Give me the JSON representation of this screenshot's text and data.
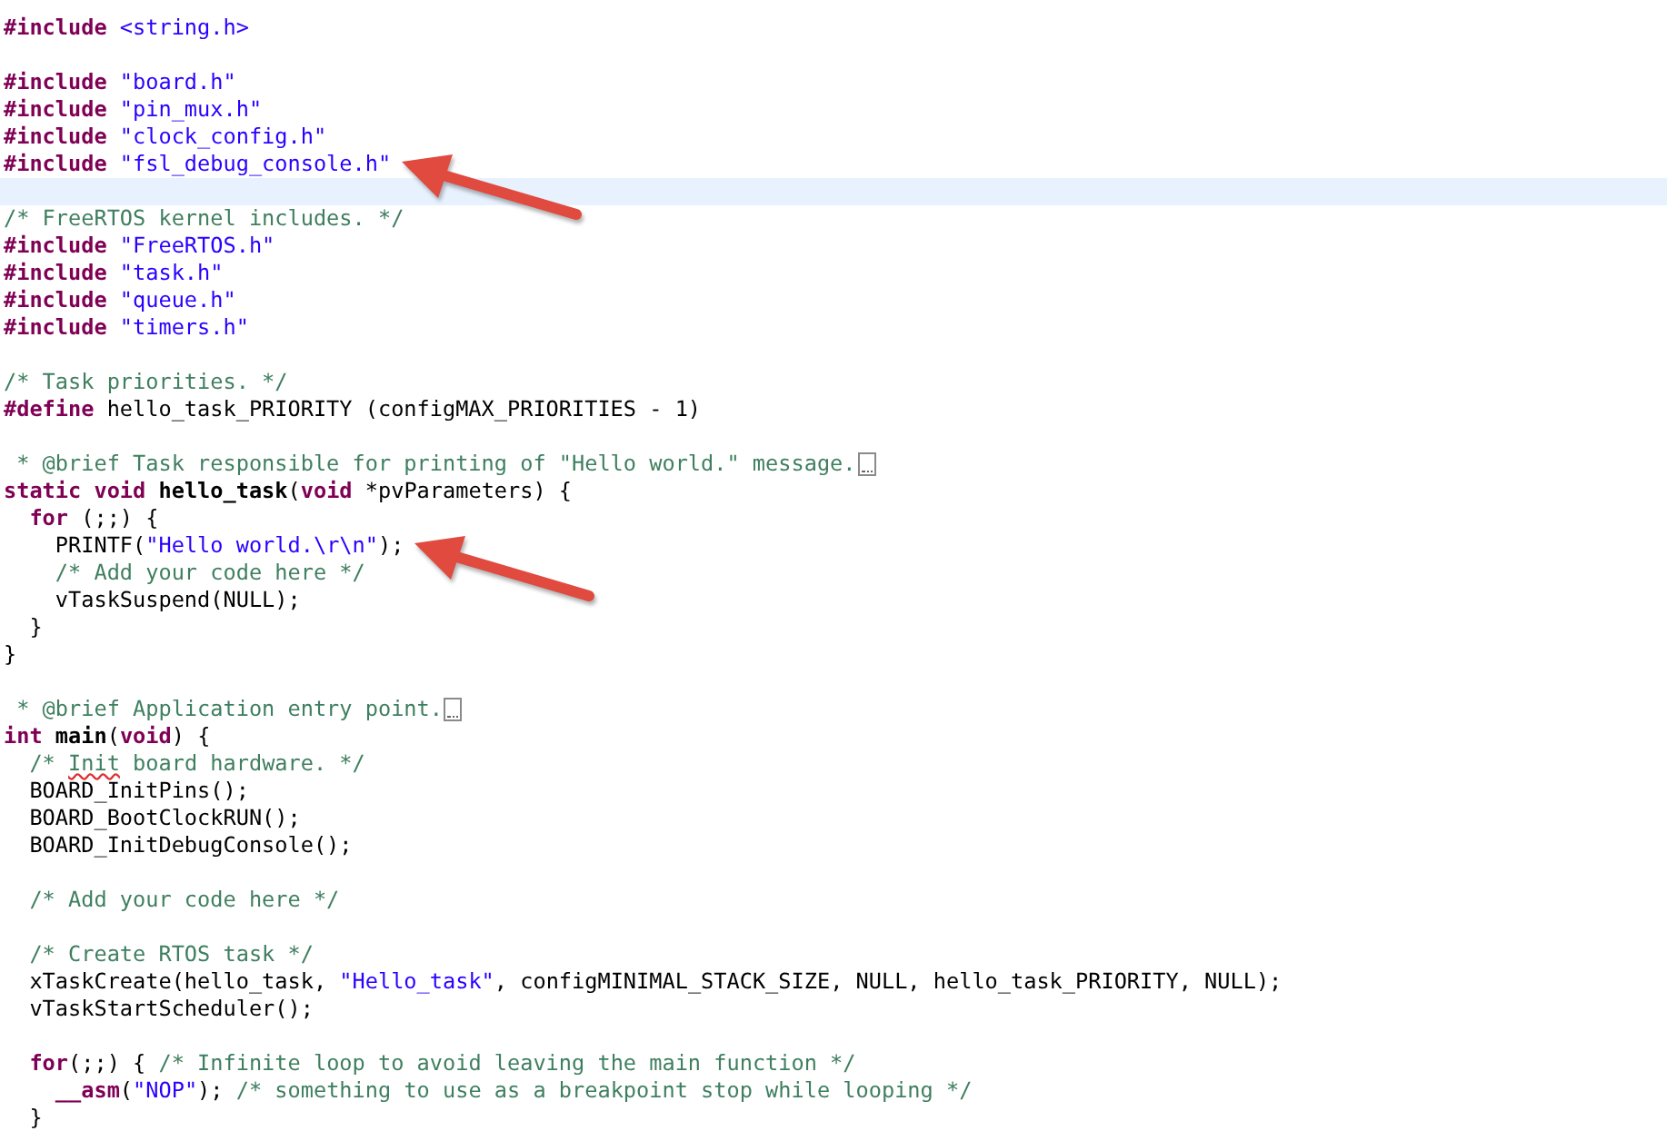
{
  "lines": [
    {
      "kind": "code",
      "tokens": [
        {
          "kind": "keyword",
          "text": "#include "
        },
        {
          "kind": "string",
          "text": "<string.h>"
        }
      ]
    },
    {
      "kind": "blank"
    },
    {
      "kind": "code",
      "tokens": [
        {
          "kind": "keyword",
          "text": "#include "
        },
        {
          "kind": "string",
          "text": "\"board.h\""
        }
      ]
    },
    {
      "kind": "code",
      "tokens": [
        {
          "kind": "keyword",
          "text": "#include "
        },
        {
          "kind": "string",
          "text": "\"pin_mux.h\""
        }
      ]
    },
    {
      "kind": "code",
      "tokens": [
        {
          "kind": "keyword",
          "text": "#include "
        },
        {
          "kind": "string",
          "text": "\"clock_config.h\""
        }
      ]
    },
    {
      "kind": "code",
      "tokens": [
        {
          "kind": "keyword",
          "text": "#include "
        },
        {
          "kind": "string",
          "text": "\"fsl_debug_console.h\""
        }
      ],
      "arrow": true
    },
    {
      "kind": "blank",
      "current": true
    },
    {
      "kind": "code",
      "tokens": [
        {
          "kind": "comment",
          "text": "/* FreeRTOS kernel includes. */"
        }
      ]
    },
    {
      "kind": "code",
      "tokens": [
        {
          "kind": "keyword",
          "text": "#include "
        },
        {
          "kind": "string",
          "text": "\"FreeRTOS.h\""
        }
      ]
    },
    {
      "kind": "code",
      "tokens": [
        {
          "kind": "keyword",
          "text": "#include "
        },
        {
          "kind": "string",
          "text": "\"task.h\""
        }
      ]
    },
    {
      "kind": "code",
      "tokens": [
        {
          "kind": "keyword",
          "text": "#include "
        },
        {
          "kind": "string",
          "text": "\"queue.h\""
        }
      ]
    },
    {
      "kind": "code",
      "tokens": [
        {
          "kind": "keyword",
          "text": "#include "
        },
        {
          "kind": "string",
          "text": "\"timers.h\""
        }
      ]
    },
    {
      "kind": "blank"
    },
    {
      "kind": "code",
      "tokens": [
        {
          "kind": "comment",
          "text": "/* Task priorities. */"
        }
      ]
    },
    {
      "kind": "code",
      "tokens": [
        {
          "kind": "keyword",
          "text": "#define"
        },
        {
          "kind": "plain",
          "text": " hello_task_PRIORITY (configMAX_PRIORITIES - 1)"
        }
      ]
    },
    {
      "kind": "blank"
    },
    {
      "kind": "code",
      "tokens": [
        {
          "kind": "comment",
          "text": " * @brief Task responsible for printing of \"Hello world.\" message."
        }
      ],
      "folded": true
    },
    {
      "kind": "code",
      "tokens": [
        {
          "kind": "keyword",
          "text": "static void "
        },
        {
          "kind": "function",
          "text": "hello_task"
        },
        {
          "kind": "plain",
          "text": "("
        },
        {
          "kind": "keyword",
          "text": "void"
        },
        {
          "kind": "plain",
          "text": " *pvParameters) {"
        }
      ]
    },
    {
      "kind": "code",
      "tokens": [
        {
          "kind": "keyword",
          "text": "  for"
        },
        {
          "kind": "plain",
          "text": " (;;) {"
        }
      ]
    },
    {
      "kind": "code",
      "tokens": [
        {
          "kind": "plain",
          "text": "    PRINTF("
        },
        {
          "kind": "string",
          "text": "\"Hello world.\\r\\n\""
        },
        {
          "kind": "plain",
          "text": ");"
        }
      ],
      "arrow": true
    },
    {
      "kind": "code",
      "tokens": [
        {
          "kind": "comment",
          "text": "    /* Add your code here */"
        }
      ]
    },
    {
      "kind": "code",
      "tokens": [
        {
          "kind": "plain",
          "text": "    vTaskSuspend(NULL);"
        }
      ]
    },
    {
      "kind": "code",
      "tokens": [
        {
          "kind": "plain",
          "text": "  }"
        }
      ]
    },
    {
      "kind": "code",
      "tokens": [
        {
          "kind": "plain",
          "text": "}"
        }
      ]
    },
    {
      "kind": "blank"
    },
    {
      "kind": "code",
      "tokens": [
        {
          "kind": "comment",
          "text": " * @brief Application entry point."
        }
      ],
      "folded": true
    },
    {
      "kind": "code",
      "tokens": [
        {
          "kind": "keyword",
          "text": "int "
        },
        {
          "kind": "function",
          "text": "main"
        },
        {
          "kind": "plain",
          "text": "("
        },
        {
          "kind": "keyword",
          "text": "void"
        },
        {
          "kind": "plain",
          "text": ") {"
        }
      ]
    },
    {
      "kind": "code",
      "tokens": [
        {
          "kind": "comment",
          "text": "  /* "
        },
        {
          "kind": "misspelled",
          "text": "Init"
        },
        {
          "kind": "comment",
          "text": " board hardware. */"
        }
      ]
    },
    {
      "kind": "code",
      "tokens": [
        {
          "kind": "plain",
          "text": "  BOARD_InitPins();"
        }
      ]
    },
    {
      "kind": "code",
      "tokens": [
        {
          "kind": "plain",
          "text": "  BOARD_BootClockRUN();"
        }
      ]
    },
    {
      "kind": "code",
      "tokens": [
        {
          "kind": "plain",
          "text": "  BOARD_InitDebugConsole();"
        }
      ]
    },
    {
      "kind": "blank"
    },
    {
      "kind": "code",
      "tokens": [
        {
          "kind": "comment",
          "text": "  /* Add your code here */"
        }
      ]
    },
    {
      "kind": "blank"
    },
    {
      "kind": "code",
      "tokens": [
        {
          "kind": "comment",
          "text": "  /* Create RTOS task */"
        }
      ]
    },
    {
      "kind": "code",
      "tokens": [
        {
          "kind": "plain",
          "text": "  xTaskCreate(hello_task, "
        },
        {
          "kind": "string",
          "text": "\"Hello_task\""
        },
        {
          "kind": "plain",
          "text": ", configMINIMAL_STACK_SIZE, NULL, hello_task_PRIORITY, NULL);"
        }
      ]
    },
    {
      "kind": "code",
      "tokens": [
        {
          "kind": "plain",
          "text": "  vTaskStartScheduler();"
        }
      ]
    },
    {
      "kind": "blank"
    },
    {
      "kind": "code",
      "tokens": [
        {
          "kind": "keyword",
          "text": "  for"
        },
        {
          "kind": "plain",
          "text": "(;;) { "
        },
        {
          "kind": "comment",
          "text": "/* Infinite loop to avoid leaving the main function */"
        }
      ]
    },
    {
      "kind": "code",
      "tokens": [
        {
          "kind": "keyword",
          "text": "    __asm"
        },
        {
          "kind": "plain",
          "text": "("
        },
        {
          "kind": "string",
          "text": "\"NOP\""
        },
        {
          "kind": "plain",
          "text": "); "
        },
        {
          "kind": "comment",
          "text": "/* something to use as a breakpoint stop while looping */"
        }
      ]
    },
    {
      "kind": "code",
      "tokens": [
        {
          "kind": "plain",
          "text": "  }"
        }
      ]
    }
  ]
}
